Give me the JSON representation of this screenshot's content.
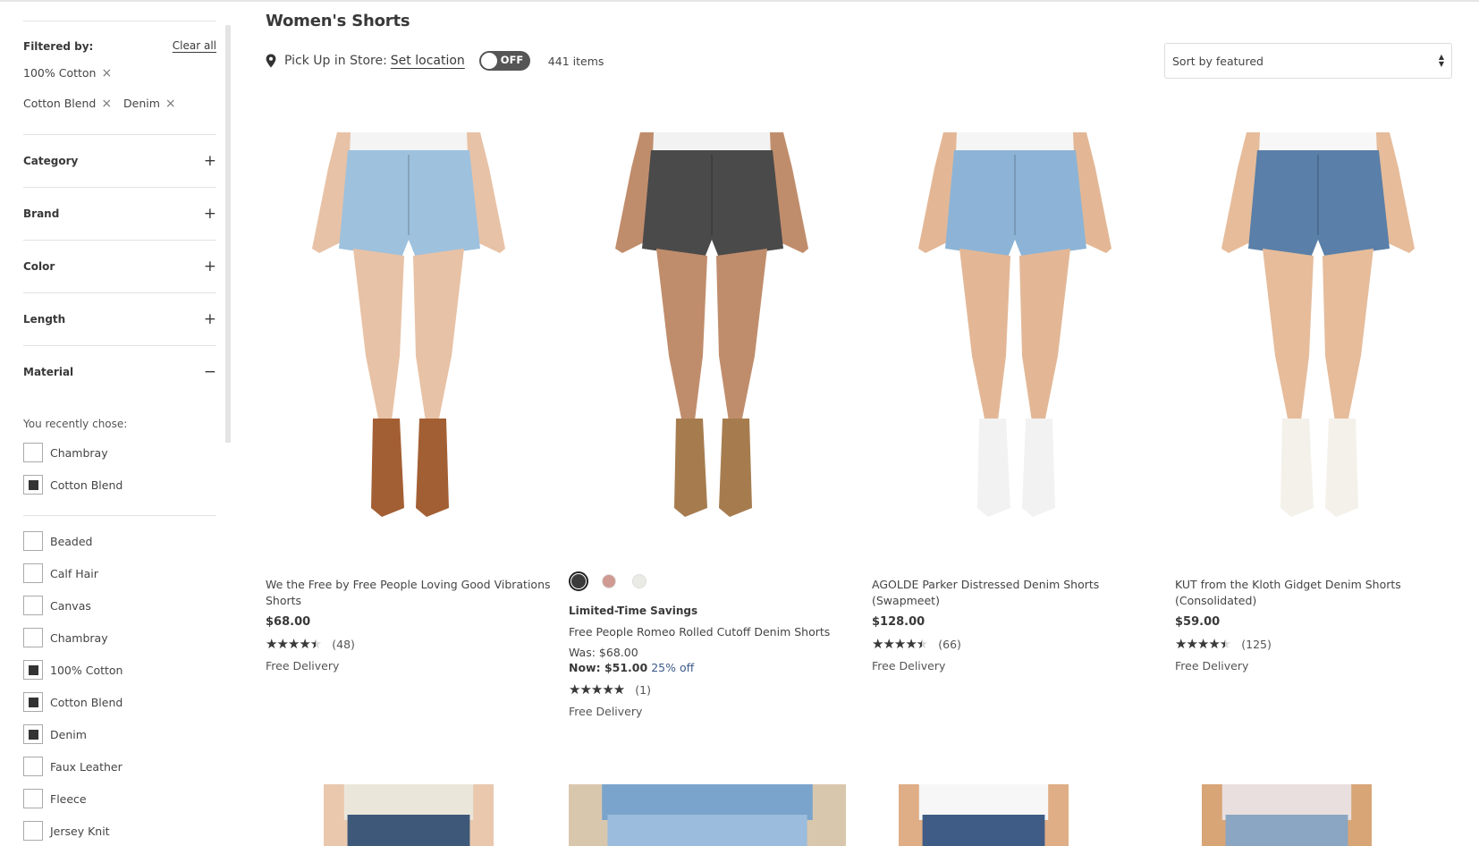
{
  "sidebar": {
    "filtered_by_label": "Filtered by:",
    "clear_all_label": "Clear all",
    "active_filters": [
      "100% Cotton",
      "Cotton Blend",
      "Denim"
    ],
    "remove_icon": "×",
    "facets": [
      {
        "label": "Category",
        "icon": "+",
        "expanded": false
      },
      {
        "label": "Brand",
        "icon": "+",
        "expanded": false
      },
      {
        "label": "Color",
        "icon": "+",
        "expanded": false
      },
      {
        "label": "Length",
        "icon": "+",
        "expanded": false
      },
      {
        "label": "Material",
        "icon": "−",
        "expanded": true
      }
    ],
    "material": {
      "recent_label": "You recently chose:",
      "recent": [
        {
          "label": "Chambray",
          "checked": false
        },
        {
          "label": "Cotton Blend",
          "checked": true
        }
      ],
      "options": [
        {
          "label": "Beaded",
          "checked": false
        },
        {
          "label": "Calf Hair",
          "checked": false
        },
        {
          "label": "Canvas",
          "checked": false
        },
        {
          "label": "Chambray",
          "checked": false
        },
        {
          "label": "100% Cotton",
          "checked": true
        },
        {
          "label": "Cotton Blend",
          "checked": true
        },
        {
          "label": "Denim",
          "checked": true
        },
        {
          "label": "Faux Leather",
          "checked": false
        },
        {
          "label": "Fleece",
          "checked": false
        },
        {
          "label": "Jersey Knit",
          "checked": false
        }
      ]
    }
  },
  "header": {
    "title": "Women's Shorts",
    "pickup_label": "Pick Up in Store:",
    "set_location_label": "Set location",
    "toggle_label": "OFF",
    "toggle_on": false,
    "items_count": "441 items",
    "sort_value": "Sort by featured"
  },
  "products": [
    {
      "name": "We the Free by Free People Loving Good Vibrations Shorts",
      "price": "$68.00",
      "rating": 4.5,
      "review_count": "(48)",
      "delivery": "Free Delivery",
      "colors": {
        "denim": "#9ec1dd",
        "shoe": "#a35f34",
        "skin": "#e8c2a6",
        "shirt": "#f4f4f4"
      }
    },
    {
      "name": "Free People Romeo Rolled Cutoff Denim Shorts",
      "promo": "Limited-Time Savings",
      "was_price": "Was: $68.00",
      "now_label": "Now:",
      "now_price": "$51.00",
      "discount": "25% off",
      "rating": 5,
      "review_count": "(1)",
      "delivery": "Free Delivery",
      "swatches": [
        {
          "name": "black",
          "color": "#3b3b3b",
          "selected": true
        },
        {
          "name": "pink-stripe",
          "color": "#cf9a92",
          "selected": false
        },
        {
          "name": "white",
          "color": "#ebebe6",
          "selected": false
        }
      ],
      "colors": {
        "denim": "#4a4a4a",
        "shoe": "#a67c4f",
        "skin": "#c08d6c",
        "shirt": "#f2f2f2"
      }
    },
    {
      "name": "AGOLDE Parker Distressed Denim Shorts (Swapmeet)",
      "price": "$128.00",
      "rating": 4.5,
      "review_count": "(66)",
      "delivery": "Free Delivery",
      "colors": {
        "denim": "#8db4d6",
        "shoe": "#f2f2f2",
        "skin": "#e3b796",
        "shirt": "#f5f5f5"
      }
    },
    {
      "name": "KUT from the Kloth Gidget Denim Shorts (Consolidated)",
      "price": "$59.00",
      "rating": 4.5,
      "review_count": "(125)",
      "delivery": "Free Delivery",
      "colors": {
        "denim": "#5a7fa8",
        "shoe": "#f4f1ea",
        "skin": "#e6bc9b",
        "shirt": "#f7f7f7"
      }
    }
  ],
  "next_row": [
    {
      "top": "#ebe6da",
      "denim": "#3d5878",
      "skin": "#e9c8ae"
    },
    {
      "top": "#7ba4cc",
      "denim": "#9bbcdc",
      "skin": "#d9c7ad"
    },
    {
      "top": "#f7f7f7",
      "denim": "#3e5c85",
      "skin": "#dfad86"
    },
    {
      "top": "#e9dfdf",
      "denim": "#8aa6c2",
      "skin": "#d8a577"
    }
  ]
}
